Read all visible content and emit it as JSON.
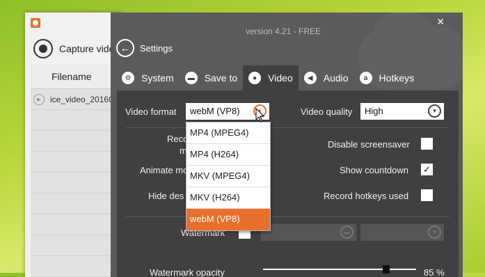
{
  "background_app": {
    "capture_label": "Capture vide",
    "column_header": "Filename",
    "row": "ice_video_20160"
  },
  "settings": {
    "version": "version 4.21 - FREE",
    "close_glyph": "✕",
    "back_label": "Settings",
    "tabs": [
      {
        "label": "System",
        "icon": "gear-icon"
      },
      {
        "label": "Save to",
        "icon": "folder-icon"
      },
      {
        "label": "Video",
        "icon": "record-icon"
      },
      {
        "label": "Audio",
        "icon": "speaker-icon"
      },
      {
        "label": "Hotkeys",
        "icon": "hotkey-icon"
      }
    ],
    "active_tab": "Video",
    "video": {
      "format_label": "Video format",
      "format_value": "webM (VP8)",
      "quality_label": "Video quality",
      "quality_value": "High",
      "record_label_a": "Reco",
      "record_label_b": "m",
      "animate_label": "Animate mo",
      "hide_label": "Hide des",
      "disable_ss_label": "Disable screensaver",
      "disable_ss_checked": false,
      "countdown_label": "Show countdown",
      "countdown_checked": true,
      "hotkeys_used_label": "Record hotkeys used",
      "hotkeys_used_checked": false,
      "watermark_label": "Watermark",
      "watermark_opacity_label": "Watermark opacity",
      "watermark_opacity_value": "85 %",
      "watermark_opacity_fraction": 0.85
    },
    "format_options": [
      "MP4 (MPEG4)",
      "MP4 (H264)",
      "MKV (MPEG4)",
      "MKV (H264)",
      "webM (VP8)"
    ],
    "selected_option": "webM (VP8)",
    "accent_color": "#e8702a"
  }
}
